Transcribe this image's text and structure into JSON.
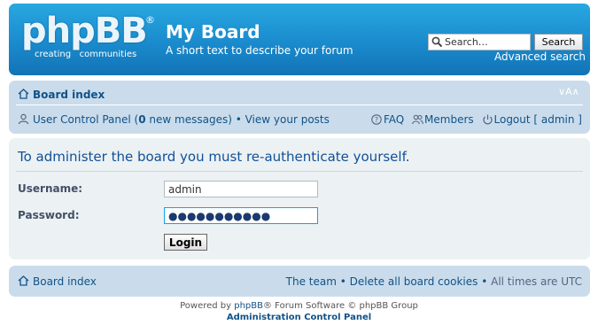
{
  "header": {
    "logo_main": "phpBB",
    "logo_reg": "®",
    "logo_tagline": "creating   communities",
    "site_title": "My Board",
    "site_description": "A short text to describe your forum",
    "search_value": "Search…",
    "search_button": "Search",
    "advanced_search": "Advanced search"
  },
  "navbar": {
    "board_index": "Board index",
    "font_size_toggle": "∨A∧",
    "ucp_label": "User Control Panel",
    "ucp_open": " (",
    "new_count": "0",
    "new_messages": " new messages)",
    "bullet": " • ",
    "view_posts": "View your posts",
    "faq": "FAQ",
    "members": "Members",
    "logout": "Logout [ admin ]"
  },
  "panel": {
    "title": "To administer the board you must re-authenticate yourself.",
    "username_label": "Username:",
    "username_value": "admin",
    "password_label": "Password:",
    "password_value": "●●●●●●●●●●●",
    "login_button": "Login"
  },
  "footer_nav": {
    "board_index": "Board index",
    "the_team": "The team",
    "bullet": " • ",
    "delete_cookies": "Delete all board cookies",
    "timezone": "All times are UTC"
  },
  "copyright": {
    "powered_prefix": "Powered by ",
    "phpbb_link": "phpBB",
    "powered_suffix": "® Forum Software © phpBB Group",
    "acp_link": "Administration Control Panel"
  },
  "colors": {
    "header_blue": "#1a8bcd",
    "navbar_bg": "#cadceb",
    "panel_bg": "#ecf1f3",
    "link": "#105289"
  }
}
